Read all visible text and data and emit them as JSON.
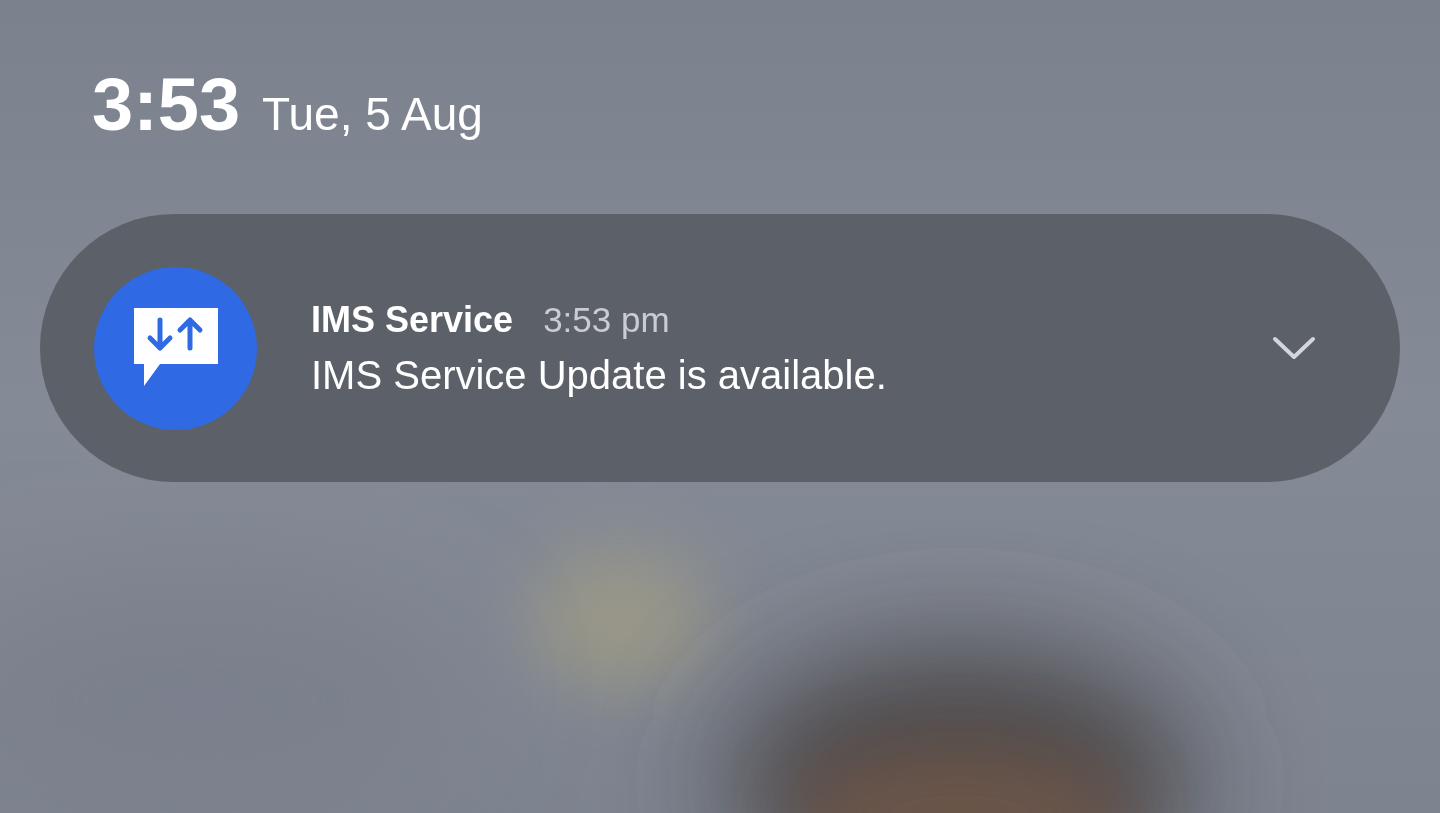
{
  "lock_screen": {
    "time": "3:53",
    "date": "Tue, 5 Aug"
  },
  "notification": {
    "app_name": "IMS Service",
    "time": "3:53 pm",
    "message": "IMS Service Update is available.",
    "expanded": false
  }
}
